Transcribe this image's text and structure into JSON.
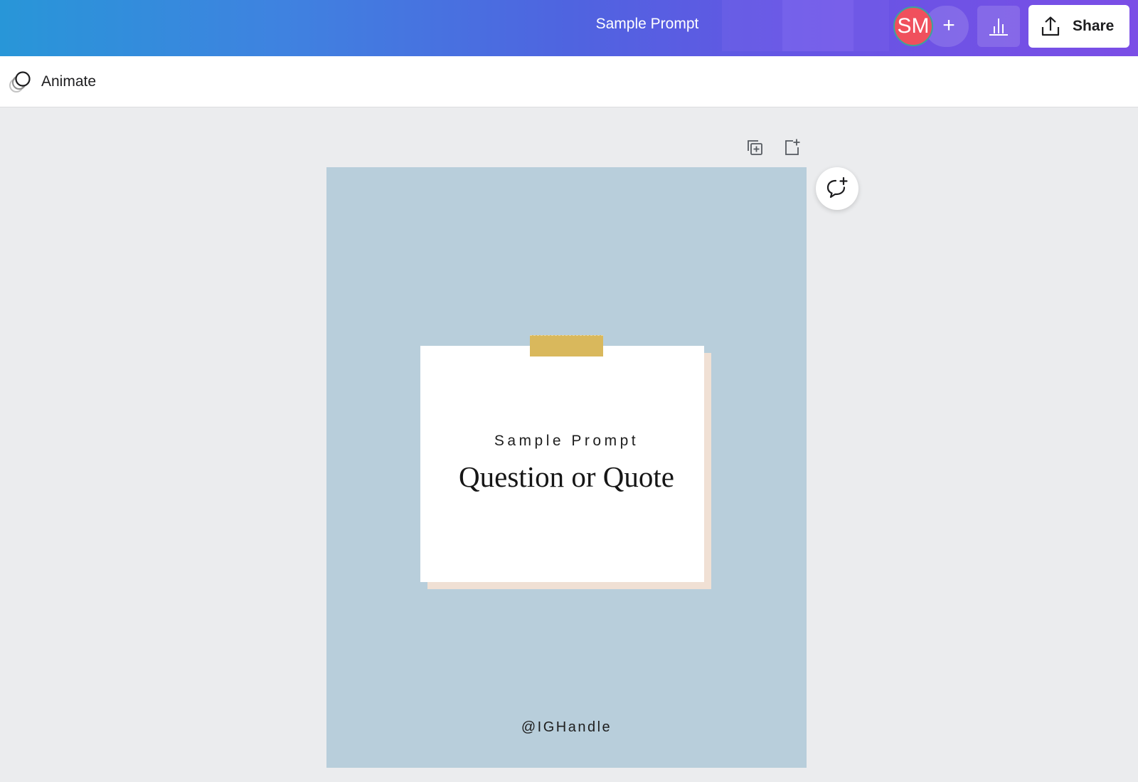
{
  "header": {
    "doc_title": "Sample Prompt",
    "avatar_initials": "SM",
    "add_collaborator_symbol": "+",
    "insights_icon": "bar-chart-icon",
    "share_label": "Share",
    "share_icon": "upload-icon"
  },
  "toolbar": {
    "animate_label": "Animate",
    "animate_icon": "animate-icon"
  },
  "page_actions": {
    "duplicate_icon": "duplicate-page-icon",
    "add_page_icon": "add-page-icon"
  },
  "canvas": {
    "background_color": "#b8cedb",
    "tape_color": "#d9b85c",
    "subtitle": "Sample Prompt",
    "headline": "Question or Quote",
    "handle": "@IGHandle"
  },
  "comment": {
    "icon": "add-comment-icon"
  },
  "colors": {
    "avatar": "#f0505d",
    "header_gradient_start": "#2896d8",
    "header_gradient_end": "#7b4ee6"
  }
}
